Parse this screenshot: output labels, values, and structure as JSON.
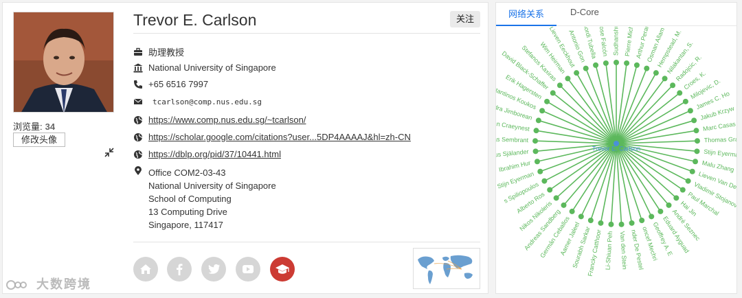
{
  "profile": {
    "name": "Trevor E. Carlson",
    "follow_label": "关注",
    "views_label": "浏览量:",
    "views_count": "34",
    "change_avatar_label": "修改头像",
    "position": "助理教授",
    "organization": "National University of Singapore",
    "phone": "+65 6516 7997",
    "email": "tcarlson@comp.nus.edu.sg",
    "links": [
      "https://www.comp.nus.edu.sg/~tcarlson/",
      "https://scholar.google.com/citations?user...5DP4AAAAJ&hl=zh-CN",
      "https://dblp.org/pid/37/10441.html"
    ],
    "address": [
      "Office COM2-03-43",
      "National University of Singapore",
      "School of Computing",
      "13 Computing Drive",
      "Singapore, 117417"
    ]
  },
  "social_icons": [
    "home-icon",
    "facebook-icon",
    "twitter-icon",
    "youtube-icon",
    "graduation-cap-icon"
  ],
  "colors": {
    "accent": "#1a73e8",
    "graph_green": "#5cb85c",
    "center_node": "#4a90d9",
    "scholar_red": "#cc3b33"
  },
  "network": {
    "tabs": [
      "网络关系",
      "D-Core"
    ],
    "center_label": "Trevor E. Carlson",
    "nodes": [
      "Antonio Gon",
      "Jordi Tubella",
      "Ayose Falcón",
      "Sudhanshu She",
      "Pierre Michaud",
      "Arthur Perais",
      "Osman Allam",
      "Hempstead, M.",
      "Nilakantan, S.",
      "Radojcic, R.",
      "Croes, K.",
      "Milojevic, D.",
      "James C. Ho",
      "Jakub Krzyw",
      "Marc Casas",
      "Thomas Grass",
      "Stijn Eyerman",
      "Malu Zhang",
      "Lieven Van Der Perre",
      "Vladimir Stojanovic",
      "Paul Marchal",
      "Hai Jin",
      "André Seznec",
      "Eduard Ayguad",
      "Geoffrey A. E",
      "oncef Mechri",
      "nder De Pestel",
      "Van den Stein",
      "Li-Shiuan Peh",
      "Francky Catthoor",
      "Sourabh Sarkar",
      "Aamer Jaleel",
      "Germán Ceballos",
      "Andreas Sandberg",
      "Nikos Nikoleris",
      "Alberto Ros",
      "s Spiliopoulos",
      "Stijn Eyerman",
      "Ibrahim Hur",
      "agnus Själander",
      "Andreas Sembrant",
      "kenzo Van Craeynest",
      "Alexandra Jimborean",
      "Konstantinos Koukos",
      "Erik Hagersten",
      "David Black-Schaffer",
      "Stefanos Kaxiras",
      "Wim Heirman",
      "Lieven Eeckhout"
    ]
  },
  "watermark": "大数跨境"
}
